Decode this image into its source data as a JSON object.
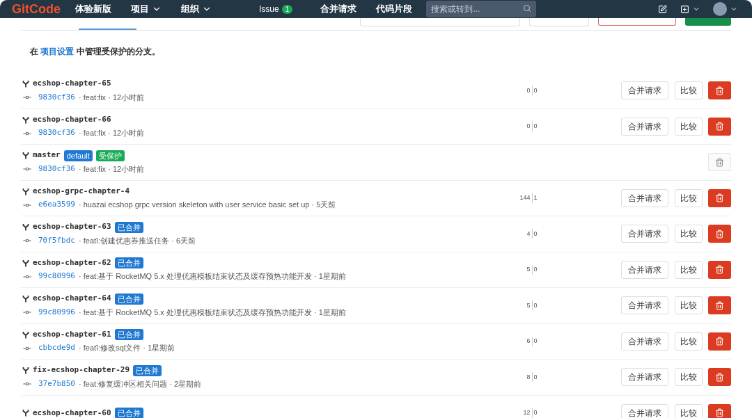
{
  "header": {
    "logo": "GitCode",
    "nav": [
      {
        "label": "体验新版",
        "kind": "link"
      },
      {
        "label": "项目",
        "kind": "dropdown"
      },
      {
        "label": "组织",
        "kind": "dropdown"
      },
      {
        "label": "Issue",
        "kind": "count",
        "count": "1"
      },
      {
        "label": "合并请求",
        "kind": "link"
      },
      {
        "label": "代码片段",
        "kind": "link"
      }
    ],
    "search": {
      "placeholder": "搜索或转到..."
    }
  },
  "notice": {
    "before": "在 ",
    "link": "项目设置",
    "after": " 中管理受保护的分支。"
  },
  "branches": [
    {
      "name": "ecshop-chapter-65",
      "hash": "9830cf36",
      "message": "· feat:fix · 12小时前",
      "divergence": {
        "behind": "0",
        "ahead": "0"
      },
      "actions": [
        {
          "kind": "merge_request",
          "label": "合并请求"
        },
        {
          "kind": "compare",
          "label": "比较"
        }
      ],
      "delete_disabled": false
    },
    {
      "name": "ecshop-chapter-66",
      "hash": "9830cf36",
      "message": "· feat:fix · 12小时前",
      "divergence": {
        "behind": "0",
        "ahead": "0"
      },
      "actions": [
        {
          "kind": "merge_request",
          "label": "合并请求"
        },
        {
          "kind": "compare",
          "label": "比较"
        }
      ],
      "delete_disabled": false
    },
    {
      "name": "master",
      "badges": [
        {
          "label": "default",
          "color": "#1f78d1"
        },
        {
          "label": "受保护",
          "color": "#1aaa55"
        }
      ],
      "hash": "9830cf36",
      "message": "· feat:fix · 12小时前",
      "delete_disabled": true
    },
    {
      "name": "ecshop-grpc-chapter-4",
      "hash": "e6ea3599",
      "message": "· huazai ecshop grpc version skeleton with user service basic set up · 5天前",
      "divergence": {
        "behind": "144",
        "ahead": "1"
      },
      "actions": [
        {
          "kind": "merge_request",
          "label": "合并请求"
        },
        {
          "kind": "compare",
          "label": "比较"
        }
      ],
      "delete_disabled": false
    },
    {
      "name": "ecshop-chapter-63",
      "badges": [
        {
          "label": "已合并",
          "color": "#1f78d1"
        }
      ],
      "hash": "70f5fbdc",
      "message": "· featī:创建优惠券推送任务 · 6天前",
      "divergence": {
        "behind": "4",
        "ahead": "0"
      },
      "actions": [
        {
          "kind": "merge_request",
          "label": "合并请求"
        },
        {
          "kind": "compare",
          "label": "比较"
        }
      ],
      "delete_disabled": false
    },
    {
      "name": "ecshop-chapter-62",
      "badges": [
        {
          "label": "已合并",
          "color": "#1f78d1"
        }
      ],
      "hash": "99c80996",
      "message": "· feat:基于 RocketMQ 5.x 处理优惠模板结束状态及缓存预热功能开发 · 1星期前",
      "divergence": {
        "behind": "5",
        "ahead": "0"
      },
      "actions": [
        {
          "kind": "merge_request",
          "label": "合并请求"
        },
        {
          "kind": "compare",
          "label": "比较"
        }
      ],
      "delete_disabled": false
    },
    {
      "name": "ecshop-chapter-64",
      "badges": [
        {
          "label": "已合并",
          "color": "#1f78d1"
        }
      ],
      "hash": "99c80996",
      "message": "· feat:基于 RocketMQ 5.x 处理优惠模板结束状态及缓存预热功能开发 · 1星期前",
      "divergence": {
        "behind": "5",
        "ahead": "0"
      },
      "actions": [
        {
          "kind": "merge_request",
          "label": "合并请求"
        },
        {
          "kind": "compare",
          "label": "比较"
        }
      ],
      "delete_disabled": false
    },
    {
      "name": "ecshop-chapter-61",
      "badges": [
        {
          "label": "已合并",
          "color": "#1f78d1"
        }
      ],
      "hash": "cbbcde9d",
      "message": "· featī:修改sql文件 · 1星期前",
      "divergence": {
        "behind": "6",
        "ahead": "0"
      },
      "actions": [
        {
          "kind": "merge_request",
          "label": "合并请求"
        },
        {
          "kind": "compare",
          "label": "比较"
        }
      ],
      "delete_disabled": false
    },
    {
      "name": "fix-ecshop-chapter-29",
      "badges": [
        {
          "label": "已合并",
          "color": "#1f78d1"
        }
      ],
      "hash": "37e7b850",
      "message": "· feat:修复缓冲区相关问题 · 2星期前",
      "divergence": {
        "behind": "8",
        "ahead": "0"
      },
      "actions": [
        {
          "kind": "merge_request",
          "label": "合并请求"
        },
        {
          "kind": "compare",
          "label": "比较"
        }
      ],
      "delete_disabled": false
    },
    {
      "name": "ecshop-chapter-60",
      "badges": [
        {
          "label": "已合并",
          "color": "#1f78d1"
        }
      ],
      "divergence": {
        "behind": "12",
        "ahead": "0"
      },
      "actions": [
        {
          "kind": "merge_request",
          "label": "合并请求"
        },
        {
          "kind": "compare",
          "label": "比较"
        }
      ],
      "delete_disabled": false
    }
  ]
}
